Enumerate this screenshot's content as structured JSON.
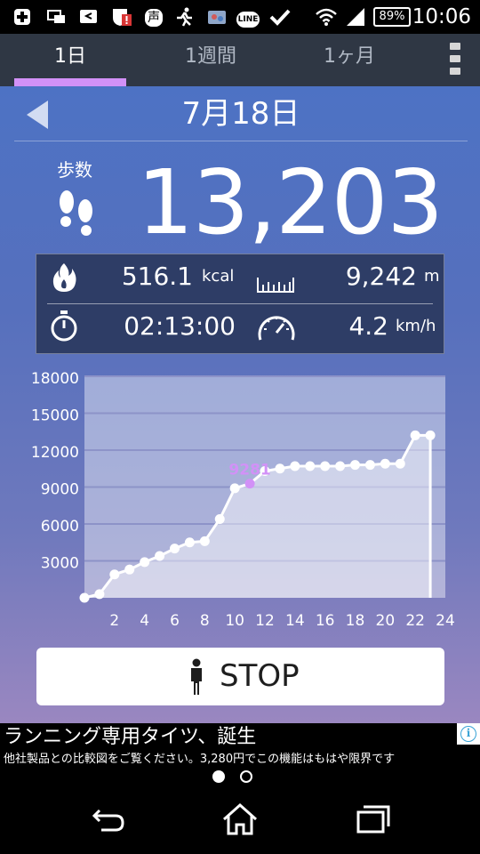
{
  "status_bar": {
    "icons": [
      "plus-icon",
      "screen-mirror-icon",
      "reply-icon",
      "shield-alert-icon",
      "voice-icon",
      "runner-icon",
      "photo-icon",
      "line-icon",
      "check-icon",
      "wifi-icon",
      "signal-icon"
    ],
    "line_label": "LINE",
    "voice_label": "声",
    "battery": "89%",
    "time": "10:06"
  },
  "tabs": [
    {
      "label": "1日",
      "active": true
    },
    {
      "label": "1週間",
      "active": false
    },
    {
      "label": "1ヶ月",
      "active": false
    }
  ],
  "header": {
    "date": "7月18日"
  },
  "steps": {
    "label": "歩数",
    "value": "13,203"
  },
  "stats": {
    "calories": {
      "value": "516.1",
      "unit": "kcal"
    },
    "distance": {
      "value": "9,242",
      "unit": "m"
    },
    "time": {
      "value": "02:13:00"
    },
    "speed": {
      "value": "4.2",
      "unit": "km/h"
    }
  },
  "chart_data": {
    "type": "line",
    "x": [
      0,
      1,
      2,
      3,
      4,
      5,
      6,
      7,
      8,
      9,
      10,
      11,
      12,
      13,
      14,
      15,
      16,
      17,
      18,
      19,
      20,
      21,
      22,
      23
    ],
    "values": [
      0,
      300,
      1900,
      2300,
      2900,
      3400,
      4000,
      4500,
      4600,
      6400,
      8900,
      9281,
      10300,
      10500,
      10700,
      10700,
      10700,
      10700,
      10800,
      10800,
      10900,
      10900,
      13203,
      13203
    ],
    "highlight": {
      "x": 11,
      "label": "9281",
      "color": "#d291f7"
    },
    "x_ticks": [
      "2",
      "4",
      "6",
      "8",
      "10",
      "12",
      "14",
      "16",
      "18",
      "20",
      "22",
      "24"
    ],
    "y_ticks": [
      "18000",
      "15000",
      "12000",
      "9000",
      "6000",
      "3000"
    ],
    "xlim": [
      0,
      24
    ],
    "ylim": [
      0,
      18000
    ],
    "grid": true,
    "colors": {
      "line": "#ffffff",
      "fill": "rgba(255,255,255,0.45)",
      "plot_bg": "rgba(255,255,255,0.42)",
      "grid": "#8d93c8"
    }
  },
  "stop_button": {
    "label": "STOP"
  },
  "ad": {
    "title": "ランニング専用タイツ、誕生",
    "description": "他社製品との比較図をご覧ください。3,280円でこの機能はもはや限界です",
    "info_icon": "i"
  },
  "pager": {
    "count": 2,
    "active": 1
  },
  "nav": [
    "back-icon",
    "home-icon",
    "recent-apps-icon"
  ]
}
